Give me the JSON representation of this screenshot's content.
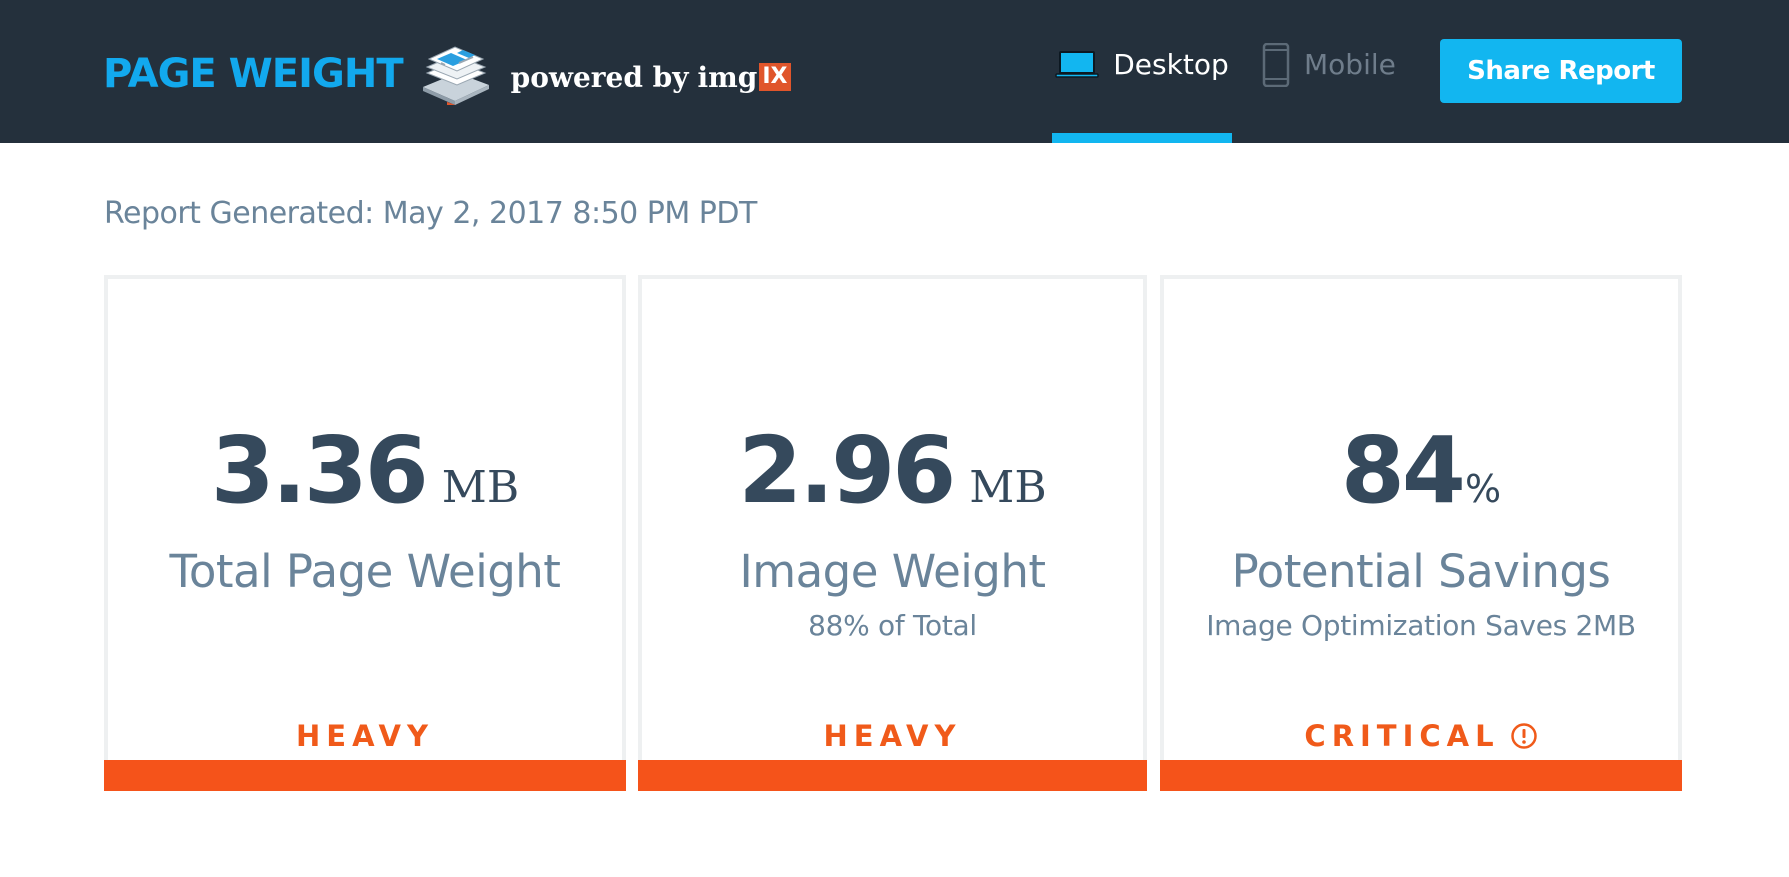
{
  "header": {
    "brand_title": "PAGE WEIGHT",
    "powered_by": "powered by",
    "img_word": "img",
    "ix_badge": "IX",
    "tabs": [
      {
        "label": "Desktop",
        "active": true
      },
      {
        "label": "Mobile",
        "active": false
      }
    ],
    "share_label": "Share Report"
  },
  "report": {
    "generated": "Report Generated: May 2, 2017 8:50 PM PDT"
  },
  "cards": [
    {
      "value": "3.36",
      "unit": "MB",
      "label": "Total Page Weight",
      "sublabel": "",
      "status": "HEAVY"
    },
    {
      "value": "2.96",
      "unit": "MB",
      "label": "Image Weight",
      "sublabel": "88% of Total",
      "status": "HEAVY"
    },
    {
      "value": "84",
      "unit": "%",
      "label": "Potential Savings",
      "sublabel": "Image Optimization Saves 2MB",
      "status": "CRITICAL",
      "status_icon": "alert-circle-icon"
    }
  ],
  "colors": {
    "header_bg": "#24303c",
    "brand_blue": "#12a9ee",
    "accent": "#12b6f0",
    "status_orange": "#f5531a",
    "value_text": "#35495c",
    "label_text": "#6a849a"
  }
}
